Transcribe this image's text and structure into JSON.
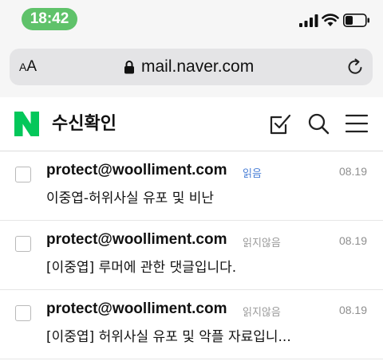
{
  "status_bar": {
    "time": "18:42",
    "time_pill_color": "#5fc26a"
  },
  "browser": {
    "text_size_label_small": "A",
    "text_size_label_large": "A",
    "url": "mail.naver.com"
  },
  "header": {
    "logo_color": "#03c75a",
    "title": "수신확인"
  },
  "mails": [
    {
      "sender": "protect@woolliment.com",
      "status": "읽음",
      "date": "08.19",
      "subject": "이중엽-허위사실 유포 및 비난"
    },
    {
      "sender": "protect@woolliment.com",
      "status": "읽지않음",
      "date": "08.19",
      "subject": "[이중엽] 루머에 관한 댓글입니다."
    },
    {
      "sender": "protect@woolliment.com",
      "status": "읽지않음",
      "date": "08.19",
      "subject": "[이중엽] 허위사실 유포 및 악플 자료입니..."
    }
  ]
}
